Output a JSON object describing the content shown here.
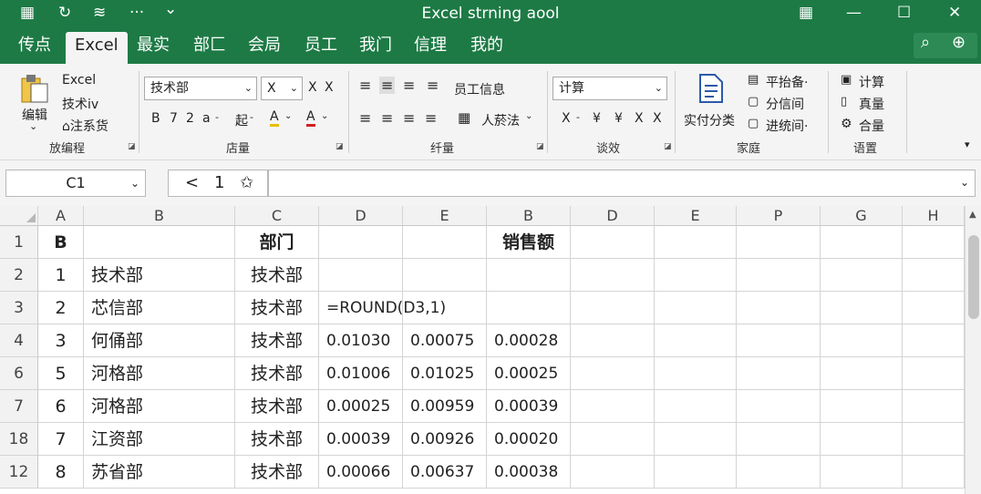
{
  "titlebar": {
    "title": "Excel strning aool",
    "icons": [
      "grid-icon",
      "refresh-icon",
      "wifi-icon",
      "more-icon",
      "chevron-down-icon",
      "table-icon",
      "minimize-icon",
      "maximize-icon",
      "close-icon"
    ],
    "glyphs": {
      "grid": "▦",
      "refresh": "↻",
      "wifi": "≋",
      "more": "···",
      "chev": "⌄",
      "table": "▦",
      "min": "—",
      "max": "☐",
      "close": "✕"
    }
  },
  "menu": {
    "tabs": [
      "传点",
      "Excel",
      "最实",
      "部匚",
      "会局",
      "员工",
      "我门",
      "信理",
      "我的"
    ],
    "search": "⌕",
    "add": "⊕"
  },
  "ribbon": {
    "clip": {
      "main": "编辑",
      "sub": "⌄",
      "excel": "Excel",
      "tech": "技术iv",
      "note": "⌂注系货",
      "group": "放编程"
    },
    "font": {
      "name": "技术部",
      "size": "X",
      "b": "B",
      "i": "7",
      "z": "2",
      "a": "a",
      "clear": "X",
      "x2": "X",
      "more": "起",
      "hl": "A",
      "fc": "A",
      "group": "店量",
      "minus": "-"
    },
    "align": {
      "emp": "员工信息",
      "people": "人菸法",
      "group": "纤量"
    },
    "number": {
      "format": "计算",
      "x1": "X",
      "yen1": "¥",
      "yen2": "¥",
      "x2": "X",
      "x3": "X",
      "minus": "-",
      "group": "谈效"
    },
    "styles": {
      "main": "实付分类",
      "a": "平抬备·",
      "b": "分信间",
      "c": "进统间·",
      "group": "家庭"
    },
    "cells": {
      "a": "计算",
      "b": "真量",
      "c": "合量",
      "group": "语置"
    }
  },
  "formula": {
    "namebox": "C1",
    "nav_back": "<",
    "nav_num": "1",
    "nav_star": "✩",
    "value": ""
  },
  "columns": [
    "A",
    "B",
    "C",
    "D",
    "E",
    "B",
    "D",
    "E",
    "P",
    "G",
    "H"
  ],
  "rows": [
    {
      "hdr": "1",
      "cells": [
        "B",
        "",
        "部门",
        "",
        "",
        "销售额",
        "",
        "",
        "",
        "",
        ""
      ]
    },
    {
      "hdr": "2",
      "cells": [
        "1",
        "技术部",
        "技术部",
        "",
        "",
        "",
        "",
        "",
        "",
        "",
        ""
      ]
    },
    {
      "hdr": "3",
      "cells": [
        "2",
        "芯信部",
        "技术部",
        "=ROUND(D3,1)",
        "",
        "",
        "",
        "",
        "",
        "",
        ""
      ]
    },
    {
      "hdr": "4",
      "cells": [
        "3",
        "何俑部",
        "技术部",
        "0.01030",
        "0.00075",
        "0.00028",
        "",
        "",
        "",
        "",
        ""
      ]
    },
    {
      "hdr": "6",
      "cells": [
        "5",
        "河格部",
        "技术部",
        "0.01006",
        "0.01025",
        "0.00025",
        "",
        "",
        "",
        "",
        ""
      ]
    },
    {
      "hdr": "7",
      "cells": [
        "6",
        "河格部",
        "技术部",
        "0.00025",
        "0.00959",
        "0.00039",
        "",
        "",
        "",
        "",
        ""
      ]
    },
    {
      "hdr": "18",
      "cells": [
        "7",
        "江资部",
        "技术部",
        "0.00039",
        "0.00926",
        "0.00020",
        "",
        "",
        "",
        "",
        ""
      ]
    },
    {
      "hdr": "12",
      "cells": [
        "8",
        "苏省部",
        "技术部",
        "0.00066",
        "0.00637",
        "0.00038",
        "",
        "",
        "",
        "",
        ""
      ]
    }
  ],
  "colors": {
    "brand": "#1d7a45"
  }
}
